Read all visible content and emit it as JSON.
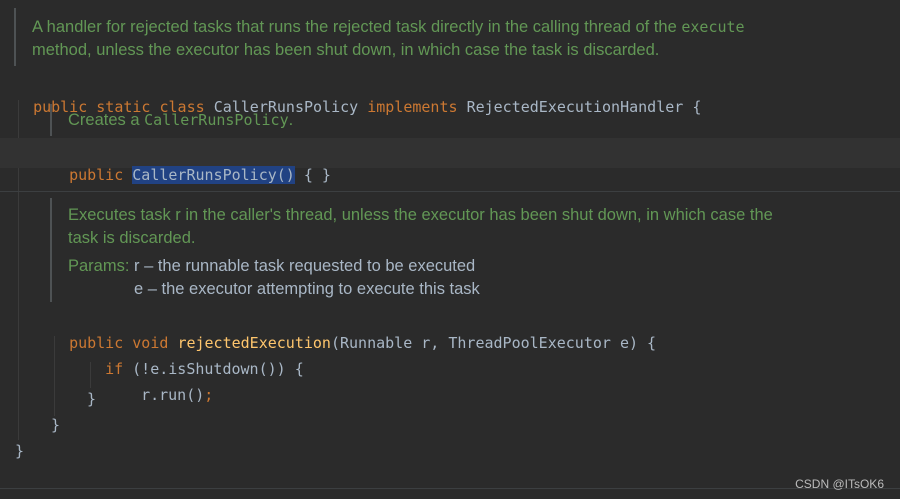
{
  "class_doc": {
    "line1_text": "A handler for rejected tasks that runs the rejected task directly in the calling thread of the ",
    "line1_code": "execute",
    "line2": "method, unless the executor has been shut down, in which case the task is discarded."
  },
  "class_decl": {
    "kw_public": "public",
    "kw_static": "static",
    "kw_class": "class",
    "name": "CallerRunsPolicy",
    "kw_implements": "implements",
    "interface": "RejectedExecutionHandler",
    "brace": "{"
  },
  "ctor_doc": {
    "text": "Creates a ",
    "code": "CallerRunsPolicy",
    "end": "."
  },
  "ctor": {
    "kw_public": "public",
    "name": "CallerRunsPolicy()",
    "body": "{ }"
  },
  "method_doc": {
    "line1": "Executes task r in the caller's thread, unless the executor has been shut down, in which case the",
    "line2": "task is discarded.",
    "params_label": "Params:",
    "param_r": "r – the runnable task requested to be executed",
    "param_e": "e – the executor attempting to execute this task"
  },
  "method": {
    "kw_public": "public",
    "kw_void": "void",
    "name": "rejectedExecution",
    "params": "(Runnable r, ThreadPoolExecutor e) {",
    "if_kw": "if",
    "if_cond": "(!e.isShutdown()) {",
    "call": "r.run()",
    "semicolon": ";",
    "close_if": "}",
    "close_method": "}"
  },
  "class_close": "}",
  "watermark": "CSDN @ITsOK6"
}
